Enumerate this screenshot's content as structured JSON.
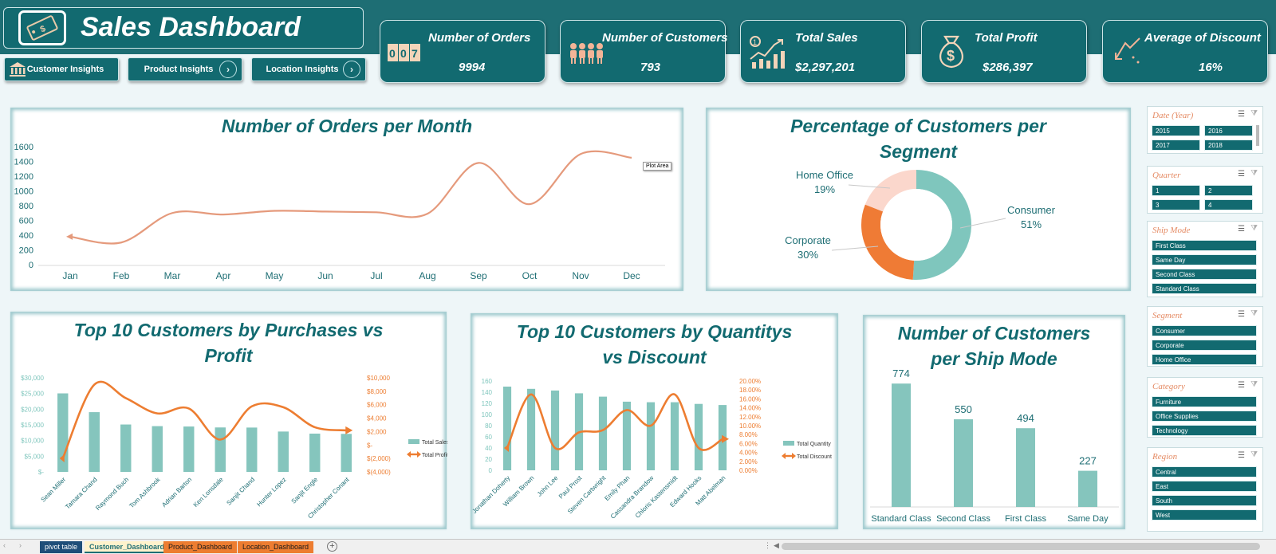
{
  "header": {
    "title": "Sales Dashboard"
  },
  "nav": {
    "customer": "Customer Insights",
    "product": "Product Insights",
    "location": "Location Insights"
  },
  "kpis": [
    {
      "label": "Number of Orders",
      "value": "9994",
      "icon": "counter-icon"
    },
    {
      "label": "Number of Customers",
      "value": "793",
      "icon": "people-icon"
    },
    {
      "label": "Total Sales",
      "value": "$2,297,201",
      "icon": "growth-chart-icon"
    },
    {
      "label": "Total Profit",
      "value": "$286,397",
      "icon": "money-bag-icon"
    },
    {
      "label": "Average of Discount",
      "value": "16%",
      "icon": "downtrend-icon"
    }
  ],
  "chart_orders": {
    "title": "Number of Orders per Month",
    "tooltip": "Plot Area"
  },
  "chart_segment": {
    "title_line1": "Percentage of Customers per",
    "title_line2": "Segment"
  },
  "chart_top10_sales": {
    "title_line1": "Top 10 Customers by Purchases vs",
    "title_line2": "Profit"
  },
  "chart_top10_qty": {
    "title_line1": "Top 10 Customers by Quantitys",
    "title_line2": "vs Discount"
  },
  "chart_shipmode": {
    "title_line1": "Number of Customers",
    "title_line2": "per Ship Mode"
  },
  "chart_data": [
    {
      "type": "line",
      "title": "Number of Orders per Month",
      "categories": [
        "Jan",
        "Feb",
        "Mar",
        "Apr",
        "May",
        "Jun",
        "Jul",
        "Aug",
        "Sep",
        "Oct",
        "Nov",
        "Dec"
      ],
      "values": [
        380,
        300,
        700,
        680,
        730,
        720,
        710,
        690,
        1380,
        820,
        1500,
        1450
      ],
      "ylim": [
        0,
        1600
      ],
      "yticks": [
        "0",
        "200",
        "400",
        "600",
        "800",
        "1000",
        "1200",
        "1400",
        "1600"
      ],
      "color": "#e59a7c"
    },
    {
      "type": "pie",
      "title": "Percentage of Customers per Segment",
      "labels": [
        "Consumer",
        "Corporate",
        "Home Office"
      ],
      "values": [
        51,
        30,
        19
      ],
      "value_labels": [
        "51%",
        "30%",
        "19%"
      ],
      "colors": [
        "#7fc6bd",
        "#ef7b35",
        "#fbd7cc"
      ]
    },
    {
      "type": "bar",
      "title": "Top 10 Customers by Purchases vs Profit",
      "categories": [
        "Sean Miller",
        "Tamara Chand",
        "Raymond Buch",
        "Tom Ashbrook",
        "Adrian Barton",
        "Ken Lonsdale",
        "Sanjit Chand",
        "Hunter Lopez",
        "Sanjit Engle",
        "Christopher Conant"
      ],
      "series": [
        {
          "name": "Total Sales",
          "values": [
            25043,
            19052,
            15117,
            14596,
            14474,
            14175,
            14142,
            12873,
            12209,
            12129
          ]
        },
        {
          "name": "Total Profit",
          "values": [
            -1980,
            8981,
            6976,
            4704,
            5445,
            807,
            5757,
            5622,
            2650,
            2177
          ]
        }
      ],
      "y_ticks": [
        "$-",
        "$5,000",
        "$10,000",
        "$15,000",
        "$20,000",
        "$25,000",
        "$30,000"
      ],
      "ylim": [
        0,
        30000
      ],
      "y2_ticks": [
        "$(4,000)",
        "$(2,000)",
        "$-",
        "$2,000",
        "$4,000",
        "$6,000",
        "$8,000",
        "$10,000"
      ],
      "y2lim": [
        -4000,
        10000
      ],
      "bar_color": "#85c5bd",
      "line_color": "#ed7d31"
    },
    {
      "type": "bar",
      "title": "Top 10 Customers by Quantitys vs Discount",
      "categories": [
        "Jonathan Doherty",
        "William Brown",
        "John Lee",
        "Paul Prost",
        "Steven Cartwright",
        "Emily Phan",
        "Cassandra Brandow",
        "Chloris Kastensmidt",
        "Edward Hooks",
        "Matt Abelman"
      ],
      "series": [
        {
          "name": "Total Quantity",
          "values": [
            150,
            146,
            143,
            138,
            132,
            123,
            122,
            122,
            119,
            117
          ]
        },
        {
          "name": "Total Discount",
          "values": [
            0.05,
            0.17,
            0.05,
            0.085,
            0.09,
            0.135,
            0.1,
            0.17,
            0.05,
            0.07
          ]
        }
      ],
      "y_ticks": [
        "0",
        "20",
        "40",
        "60",
        "80",
        "100",
        "120",
        "140",
        "160"
      ],
      "ylim": [
        0,
        160
      ],
      "y2_ticks": [
        "0.00%",
        "2.00%",
        "4.00%",
        "6.00%",
        "8.00%",
        "10.00%",
        "12.00%",
        "14.00%",
        "16.00%",
        "18.00%",
        "20.00%"
      ],
      "y2lim": [
        0,
        0.2
      ],
      "bar_color": "#85c5bd",
      "line_color": "#ed7d31"
    },
    {
      "type": "bar",
      "title": "Number of Customers per Ship Mode",
      "categories": [
        "Standard Class",
        "Second Class",
        "First Class",
        "Same Day"
      ],
      "values": [
        774,
        550,
        494,
        227
      ],
      "ylim": [
        0,
        850
      ],
      "color": "#85c5bd"
    }
  ],
  "slicers": [
    {
      "title": "Date (Year)",
      "items": [
        "2015",
        "2016",
        "2017",
        "2018"
      ]
    },
    {
      "title": "Quarter",
      "items": [
        "1",
        "2",
        "3",
        "4"
      ]
    },
    {
      "title": "Ship Mode",
      "items": [
        "First Class",
        "Same Day",
        "Second Class",
        "Standard Class"
      ]
    },
    {
      "title": "Segment",
      "items": [
        "Consumer",
        "Corporate",
        "Home Office"
      ]
    },
    {
      "title": "Category",
      "items": [
        "Furniture",
        "Office Supplies",
        "Technology"
      ]
    },
    {
      "title": "Region",
      "items": [
        "Central",
        "East",
        "South",
        "West"
      ]
    }
  ],
  "sheet_tabs": [
    {
      "label": "pivot table",
      "bg": "#1f4e79",
      "fg": "#ffffff"
    },
    {
      "label": "Customer_Dashboard",
      "bg": "#fff2cc",
      "fg": "#1e6e74"
    },
    {
      "label": "Product_Dashboard",
      "bg": "#ed7d31",
      "fg": "#1a1a1a"
    },
    {
      "label": "Location_Dashboard",
      "bg": "#ed7d31",
      "fg": "#1a1a1a"
    }
  ],
  "colors": {
    "brand": "#126a70",
    "accent": "#ed7d31",
    "teal_bar": "#85c5bd"
  }
}
